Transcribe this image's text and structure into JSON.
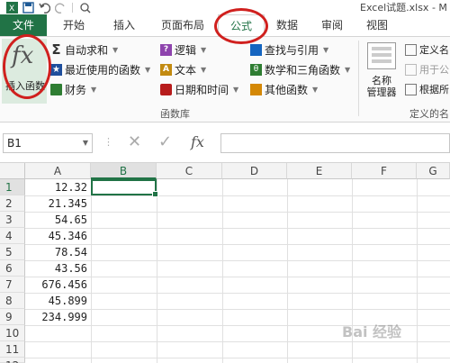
{
  "window": {
    "title": "Excel试题.xlsx - M"
  },
  "tabs": [
    {
      "label": "文件"
    },
    {
      "label": "开始"
    },
    {
      "label": "插入"
    },
    {
      "label": "页面布局"
    },
    {
      "label": "公式"
    },
    {
      "label": "数据"
    },
    {
      "label": "审阅"
    },
    {
      "label": "视图"
    }
  ],
  "ribbon": {
    "insert_function": {
      "glyph": "fx",
      "label": "插入函数"
    },
    "library_items": [
      {
        "label": "自动求和",
        "icon": "sigma-icon"
      },
      {
        "label": "最近使用的函数",
        "icon": "star-icon"
      },
      {
        "label": "财务",
        "icon": "book-icon"
      },
      {
        "label": "逻辑",
        "icon": "question-icon"
      },
      {
        "label": "文本",
        "icon": "text-icon"
      },
      {
        "label": "日期和时间",
        "icon": "clock-icon"
      },
      {
        "label": "查找与引用",
        "icon": "search-icon"
      },
      {
        "label": "数学和三角函数",
        "icon": "theta-icon"
      },
      {
        "label": "其他函数",
        "icon": "more-icon"
      }
    ],
    "library_group_label": "函数库",
    "name_manager": {
      "line1": "名称",
      "line2": "管理器"
    },
    "defined_names": [
      {
        "label": "定义名"
      },
      {
        "label": "用于公"
      },
      {
        "label": "根据所"
      }
    ],
    "defined_group_label": "定义的名"
  },
  "formula_bar": {
    "name_box": "B1",
    "cancel": "✕",
    "enter": "✓",
    "fx": "fx",
    "value": ""
  },
  "sheet": {
    "columns": [
      "A",
      "B",
      "C",
      "D",
      "E",
      "F",
      "G"
    ],
    "rows": [
      "1",
      "2",
      "3",
      "4",
      "5",
      "6",
      "7",
      "8",
      "9",
      "10",
      "11",
      "12"
    ],
    "col_a_values": [
      "12.32",
      "21.345",
      "54.65",
      "45.346",
      "78.54",
      "43.56",
      "676.456",
      "45.899",
      "234.999"
    ],
    "selected_cell": "B1"
  },
  "watermark": "Bai 经验"
}
